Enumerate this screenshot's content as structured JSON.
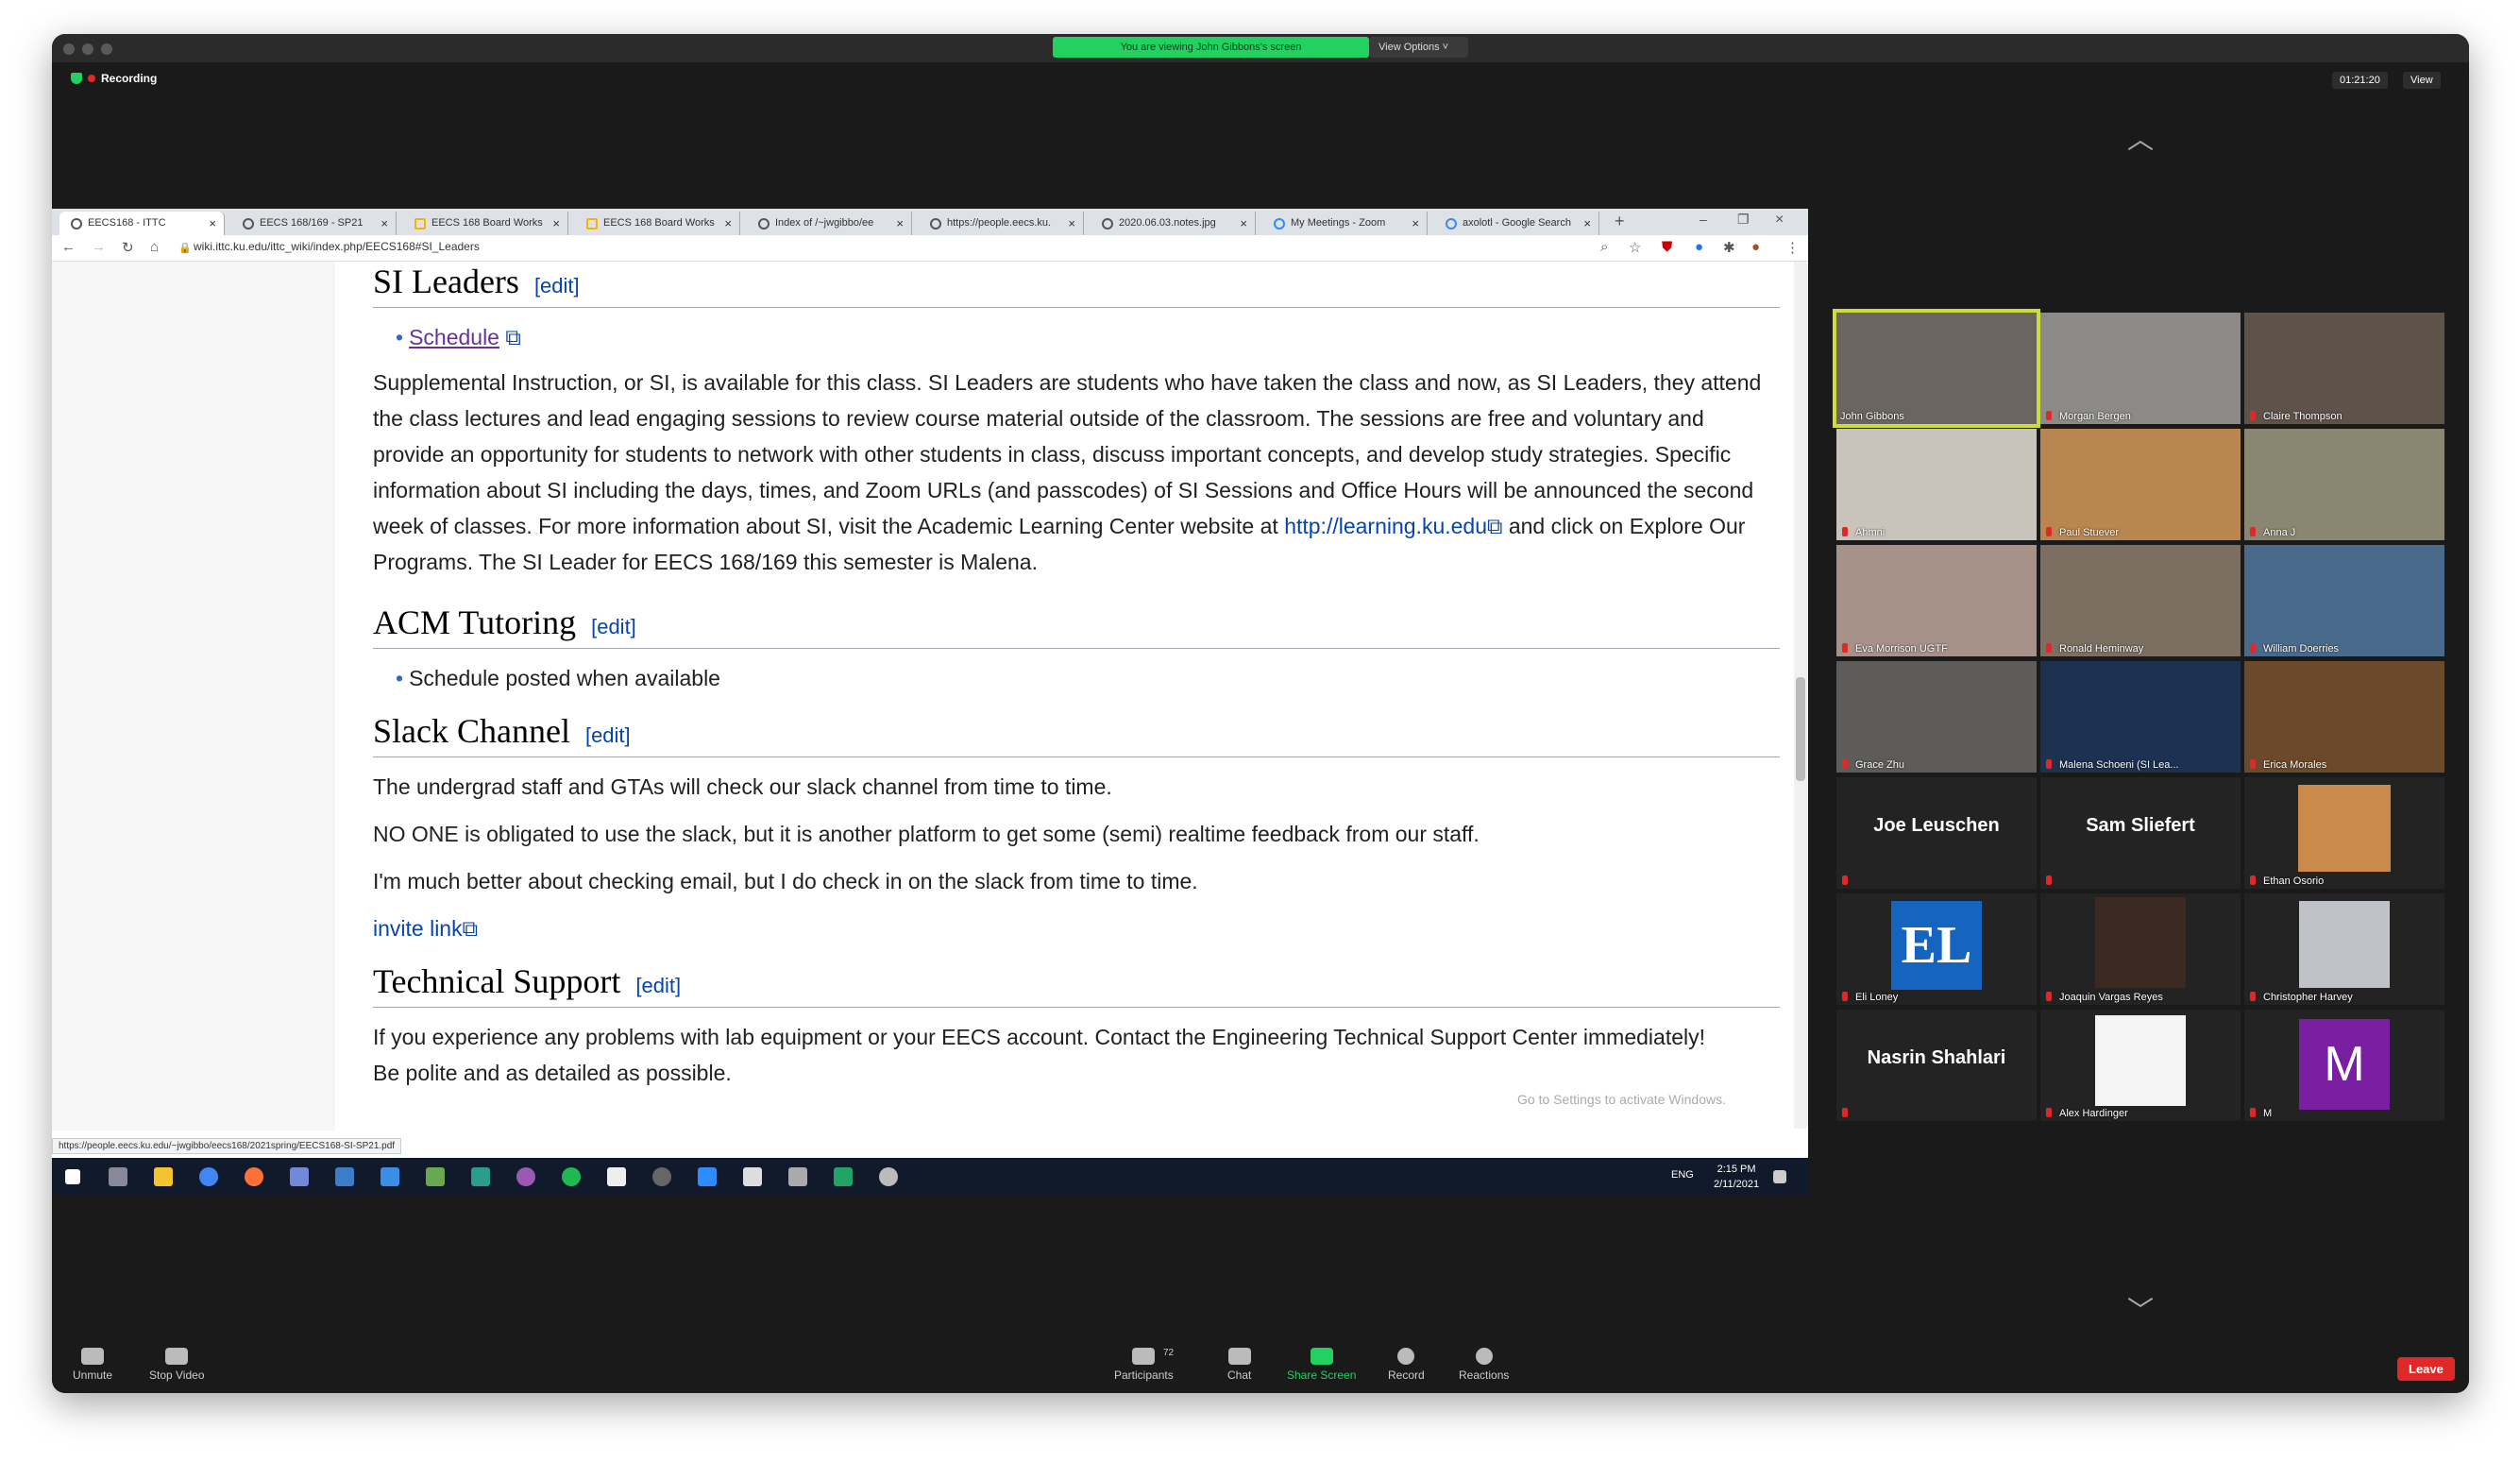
{
  "zoom": {
    "viewing_banner": "You are viewing John Gibbons's screen",
    "view_options": "View Options ˅",
    "recording": "Recording",
    "timer": "01:21:20",
    "view": "View",
    "leave": "Leave",
    "toolbar": {
      "unmute": "Unmute",
      "stop_video": "Stop Video",
      "participants": "Participants",
      "participants_count": "72",
      "chat": "Chat",
      "share_screen": "Share Screen",
      "record": "Record",
      "reactions": "Reactions"
    }
  },
  "browser": {
    "tabs": [
      "EECS168 - ITTC",
      "EECS 168/169 - SP21",
      "EECS 168 Board Works",
      "EECS 168 Board Works",
      "Index of /~jwgibbo/ee",
      "https://people.eecs.ku.",
      "2020.06.03.notes.jpg",
      "My Meetings - Zoom",
      "axolotl - Google Search"
    ],
    "url": "wiki.ittc.ku.edu/ittc_wiki/index.php/EECS168#SI_Leaders",
    "status_url": "https://people.eecs.ku.edu/~jwgibbo/eecs168/2021spring/EECS168-SI-SP21.pdf"
  },
  "article": {
    "edit": "[edit]",
    "s1_title": "SI Leaders",
    "s1_item": "Schedule",
    "s1_p_a": "Supplemental Instruction, or SI, is available for this class. SI Leaders are students who have taken the class and now, as SI Leaders, they attend the class lectures and lead engaging sessions to review course material outside of the classroom. The sessions are free and voluntary and provide an opportunity for students to network with other students in class, discuss important concepts, and develop study strategies. Specific information about SI including the days, times, and Zoom URLs (and passcodes) of SI Sessions and Office Hours will be announced the second week of classes. For more information about SI, visit the Academic Learning Center website at ",
    "s1_link": "http://learning.ku.edu",
    "s1_p_b": " and click on Explore Our Programs. The SI Leader for EECS 168/169 this semester is Malena.",
    "s2_title": "ACM Tutoring",
    "s2_item": "Schedule posted when available",
    "s3_title": "Slack Channel",
    "s3_p1": "The undergrad staff and GTAs will check our slack channel from time to time.",
    "s3_p2": "NO ONE is obligated to use the slack, but it is another platform to get some (semi) realtime feedback from our staff.",
    "s3_p3": "I'm much better about checking email, but I do check in on the slack from time to time.",
    "s3_link": "invite link",
    "s4_title": "Technical Support",
    "s4_p1": "If you experience any problems with lab equipment or your EECS account. Contact the Engineering Technical Support Center immediately!",
    "s4_p2": "Be polite and as detailed as possible.",
    "watermark": "Go to Settings to activate Windows."
  },
  "taskbar": {
    "lang": "ENG",
    "time": "2:15 PM",
    "date": "2/11/2021"
  },
  "participants": [
    "John Gibbons",
    "Morgan Bergen",
    "Claire Thompson",
    "Ahmni",
    "Paul Stuever",
    "Anna J",
    "Eva Morrison UGTF",
    "Ronald Heminway",
    "William Doerries",
    "Grace Zhu",
    "Malena Schoeni (SI Lea...",
    "Erica Morales",
    "Joe Leuschen",
    "Sam Sliefert",
    "Ethan Osorio",
    "Eli Loney",
    "Joaquin Vargas Reyes",
    "Christopher Harvey",
    "Nasrin Shahlari",
    "Alex Hardinger",
    "M"
  ],
  "tile_initials": {
    "eli": "EL",
    "m": "M"
  }
}
